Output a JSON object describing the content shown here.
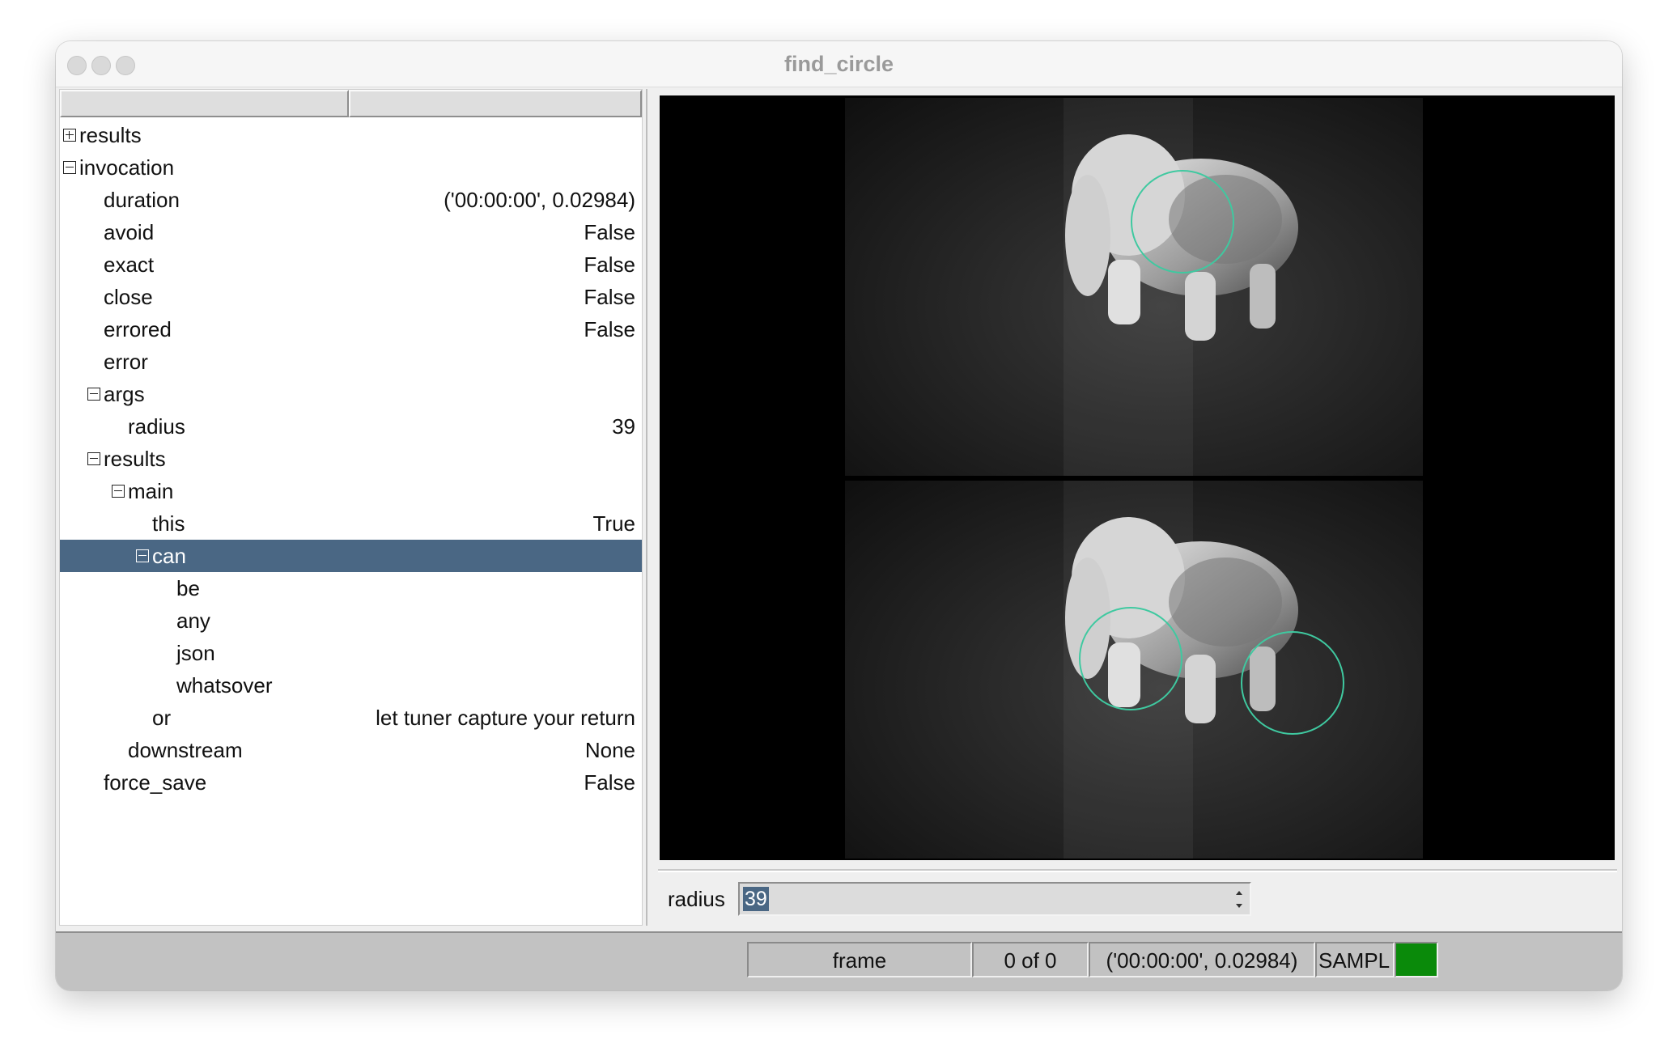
{
  "window": {
    "title": "find_circle"
  },
  "tree": {
    "rows": [
      {
        "key": "results",
        "value": "",
        "expander": "plus"
      },
      {
        "key": "invocation",
        "value": "",
        "expander": "minus"
      },
      {
        "key": "duration",
        "value": "('00:00:00', 0.02984)"
      },
      {
        "key": "avoid",
        "value": "False"
      },
      {
        "key": "exact",
        "value": "False"
      },
      {
        "key": "close",
        "value": "False"
      },
      {
        "key": "errored",
        "value": "False"
      },
      {
        "key": "error",
        "value": ""
      },
      {
        "key": "args",
        "value": "",
        "expander": "minus"
      },
      {
        "key": "radius",
        "value": "39"
      },
      {
        "key": "results",
        "value": "",
        "expander": "minus"
      },
      {
        "key": "main",
        "value": "",
        "expander": "minus"
      },
      {
        "key": "this",
        "value": "True"
      },
      {
        "key": "can",
        "value": "",
        "expander": "minus",
        "selected": true
      },
      {
        "key": "be",
        "value": ""
      },
      {
        "key": "any",
        "value": ""
      },
      {
        "key": "json",
        "value": ""
      },
      {
        "key": "whatsover",
        "value": ""
      },
      {
        "key": "or",
        "value": "let tuner capture your return"
      },
      {
        "key": "downstream",
        "value": "None"
      },
      {
        "key": "force_save",
        "value": "False"
      }
    ]
  },
  "controls": {
    "radius_label": "radius",
    "radius_value": "39"
  },
  "statusbar": {
    "frame_label": "frame",
    "frame_count": "0 of 0",
    "timing": "('00:00:00', 0.02984)",
    "mode": "SAMPL",
    "indicator_color": "#0a8a0a"
  },
  "colors": {
    "selection": "#4a6784",
    "circle": "#3fc9a0"
  }
}
